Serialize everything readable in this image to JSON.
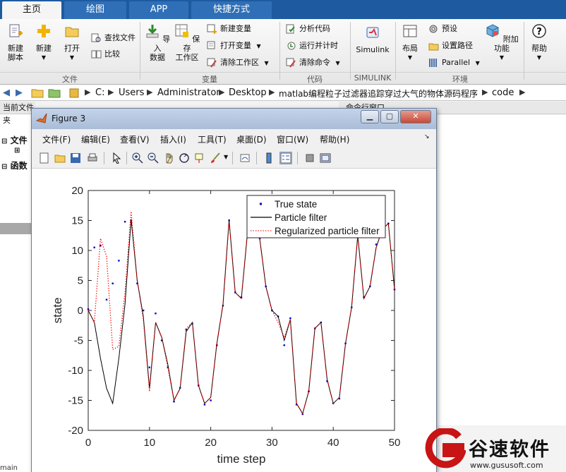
{
  "ribbon_tabs": [
    "主页",
    "绘图",
    "APP",
    "快捷方式"
  ],
  "ribbon": {
    "file_group": {
      "new_script": "新建\n脚本",
      "new": "新建",
      "open": "打开",
      "find_files": "查找文件",
      "compare": "比较",
      "label": "文件"
    },
    "variable_group": {
      "import_data": "导入\n数据",
      "save_workspace": "保存\n工作区",
      "new_variable": "新建变量",
      "open_variable": "打开变量",
      "clear_workspace": "清除工作区",
      "label": "变量"
    },
    "code_group": {
      "analyze_code": "分析代码",
      "run_and_time": "运行并计时",
      "clear_commands": "清除命令",
      "label": "代码"
    },
    "simulink_group": {
      "simulink": "Simulink",
      "label": "SIMULINK"
    },
    "env_group": {
      "layout": "布局",
      "preferences": "预设",
      "set_path": "设置路径",
      "parallel": "Parallel",
      "addons": "附加功能",
      "label": "环境"
    },
    "help": "帮助"
  },
  "address": [
    "C:",
    "Users",
    "Administrator",
    "Desktop",
    "matlab编程粒子过滤器追踪穿过大气的物体源码程序",
    "code"
  ],
  "left_panel": {
    "title": "当前文件夹",
    "row1": "文件",
    "row2": "函数"
  },
  "command_window_title": "命令行窗口",
  "figure": {
    "title": "Figure 3",
    "menus": [
      "文件(F)",
      "编辑(E)",
      "查看(V)",
      "插入(I)",
      "工具(T)",
      "桌面(D)",
      "窗口(W)",
      "帮助(H)"
    ]
  },
  "chart_data": {
    "type": "line",
    "xlabel": "time step",
    "ylabel": "state",
    "xlim": [
      0,
      50
    ],
    "ylim": [
      -20,
      20
    ],
    "xticks": [
      0,
      10,
      20,
      30,
      40,
      50
    ],
    "yticks": [
      -20,
      -15,
      -10,
      -5,
      0,
      5,
      10,
      15,
      20
    ],
    "legend_position": "top-right",
    "x": [
      0,
      1,
      2,
      3,
      4,
      5,
      6,
      7,
      8,
      9,
      10,
      11,
      12,
      13,
      14,
      15,
      16,
      17,
      18,
      19,
      20,
      21,
      22,
      23,
      24,
      25,
      26,
      27,
      28,
      29,
      30,
      31,
      32,
      33,
      34,
      35,
      36,
      37,
      38,
      39,
      40,
      41,
      42,
      43,
      44,
      45,
      46,
      47,
      48,
      49,
      50
    ],
    "series": [
      {
        "name": "True state",
        "style": "dots",
        "color": "#0000cc",
        "values": [
          0.2,
          10.5,
          10.8,
          1.8,
          4.5,
          8.3,
          14.8,
          15.0,
          4.5,
          0.0,
          -9.5,
          -0.5,
          -5.0,
          -9.5,
          -15.2,
          -12.9,
          -3.2,
          -2.2,
          -12.5,
          -15.7,
          -15.0,
          -5.8,
          0.8,
          15.0,
          3.0,
          2.2,
          13.0,
          14.0,
          12.0,
          4.0,
          0.0,
          -1.0,
          -5.8,
          -1.3,
          -15.7,
          -17.3,
          -13.5,
          -3.0,
          -2.0,
          -11.8,
          -15.5,
          -14.7,
          -5.5,
          0.5,
          13.0,
          2.2,
          4.0,
          11.0,
          13.5,
          14.5,
          3.5
        ]
      },
      {
        "name": "Particle filter",
        "style": "solid",
        "color": "#000000",
        "values": [
          0.0,
          -2.0,
          -8.0,
          -13.0,
          -15.5,
          -8.0,
          1.0,
          15.2,
          5.0,
          -1.0,
          -13.0,
          -2.0,
          -4.5,
          -9.0,
          -15.0,
          -13.0,
          -3.5,
          -2.0,
          -12.5,
          -15.5,
          -14.5,
          -5.5,
          1.0,
          15.0,
          3.0,
          2.0,
          13.0,
          14.0,
          12.0,
          4.0,
          0.0,
          -1.0,
          -5.0,
          -1.5,
          -15.5,
          -17.2,
          -13.5,
          -3.0,
          -2.0,
          -11.5,
          -15.5,
          -14.5,
          -5.5,
          0.5,
          12.5,
          2.0,
          4.0,
          10.5,
          13.5,
          14.5,
          3.5
        ]
      },
      {
        "name": "Regularized particle filter",
        "style": "dotted",
        "color": "#ff0000",
        "values": [
          0.0,
          -2.0,
          12.0,
          9.0,
          -6.5,
          -6.0,
          3.0,
          16.5,
          5.0,
          -1.5,
          -13.5,
          -2.0,
          -4.5,
          -9.5,
          -15.0,
          -13.0,
          -3.0,
          -2.0,
          -12.5,
          -15.5,
          -14.5,
          -5.5,
          1.0,
          15.2,
          3.0,
          2.0,
          13.0,
          14.0,
          12.0,
          4.0,
          0.0,
          -2.0,
          -4.5,
          -1.5,
          -15.5,
          -17.2,
          -13.5,
          -3.0,
          -2.0,
          -11.5,
          -15.5,
          -14.5,
          -5.5,
          0.5,
          12.5,
          2.0,
          4.0,
          10.5,
          13.5,
          14.5,
          3.5
        ]
      }
    ]
  },
  "watermark": {
    "name": "谷速软件",
    "url": "www.gususoft.com"
  },
  "footer_text": "main"
}
